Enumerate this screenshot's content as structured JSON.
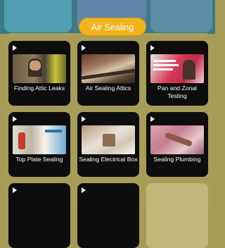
{
  "section": {
    "title": "Air Sealing"
  },
  "colors": {
    "accent": "#f2b41c",
    "panel": "#a69c58",
    "card": "#0d0d0d"
  },
  "videos": [
    {
      "label": "Finding Attic Leaks",
      "icon": "play-icon"
    },
    {
      "label": "Air Sealing Attics",
      "icon": "play-icon"
    },
    {
      "label": "Pan and Zonal Testing",
      "icon": "play-icon"
    },
    {
      "label": "Top Plate Sealing",
      "icon": "play-icon"
    },
    {
      "label": "Sealing Electrical Box",
      "icon": "play-icon"
    },
    {
      "label": "Sealing Plumbing",
      "icon": "play-icon"
    }
  ]
}
